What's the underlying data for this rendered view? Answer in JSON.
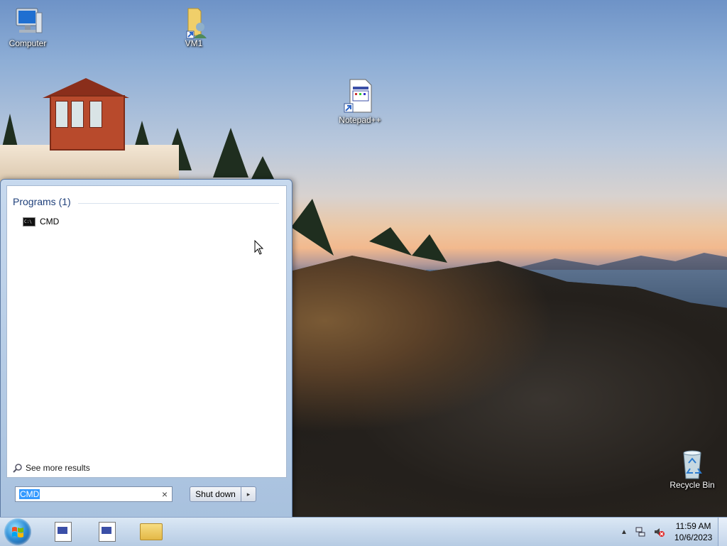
{
  "desktop": {
    "icons": [
      {
        "name": "computer",
        "label": "Computer"
      },
      {
        "name": "vm1",
        "label": "VM1"
      },
      {
        "name": "notepad-plus-plus",
        "label": "Notepad++"
      },
      {
        "name": "recycle-bin",
        "label": "Recycle Bin"
      }
    ]
  },
  "start_menu": {
    "programs_header": "Programs (1)",
    "results": [
      {
        "label": "CMD",
        "icon": "cmd-icon"
      }
    ],
    "see_more": "See more results",
    "search": {
      "value": "CMD",
      "clear_glyph": "×"
    },
    "shutdown": {
      "label": "Shut down",
      "arrow": "▸"
    }
  },
  "taskbar": {
    "pinned": [
      {
        "name": "notepad-plus-plus",
        "icon": "notepad-icon"
      },
      {
        "name": "notepad-plus-plus-2",
        "icon": "notepad-icon"
      },
      {
        "name": "windows-explorer",
        "icon": "folder-icon"
      }
    ],
    "tray_arrow": "▲",
    "clock": {
      "time": "11:59 AM",
      "date": "10/6/2023"
    }
  },
  "colors": {
    "taskbar": "#c8d9ec",
    "start_menu": "#c7d9ee",
    "search_highlight": "#3399ff",
    "programs_header": "#1e3f7a"
  }
}
